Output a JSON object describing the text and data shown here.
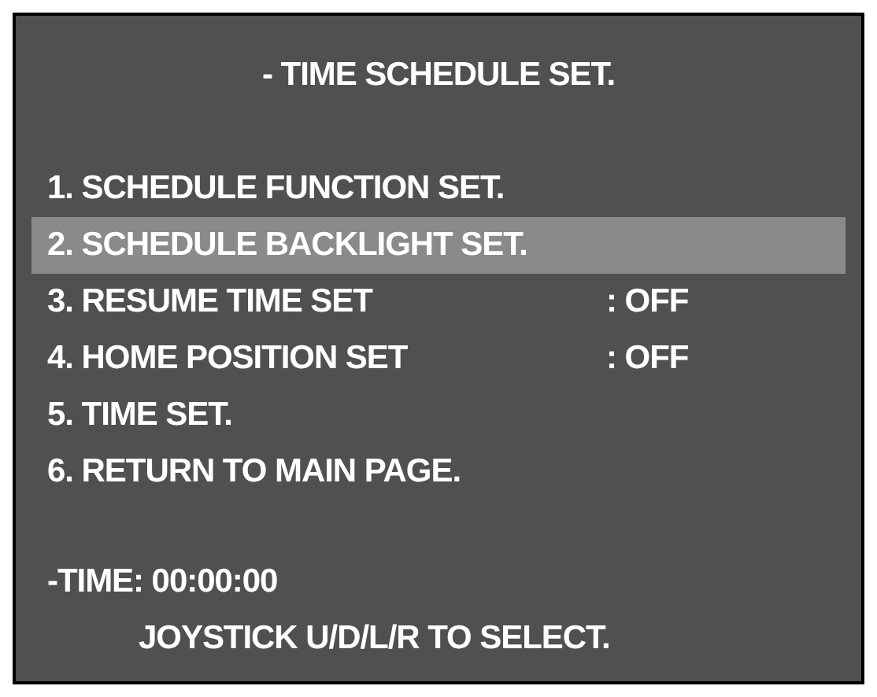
{
  "title": "- TIME SCHEDULE SET.",
  "items": [
    {
      "label": "1. SCHEDULE FUNCTION SET.",
      "selected": false
    },
    {
      "label": "2. SCHEDULE BACKLIGHT SET.",
      "selected": true
    },
    {
      "label": "3. RESUME TIME SET",
      "value": ": OFF",
      "selected": false
    },
    {
      "label": "4. HOME POSITION SET",
      "value": ": OFF",
      "selected": false
    },
    {
      "label": "5. TIME SET.",
      "selected": false
    },
    {
      "label": "6. RETURN TO MAIN PAGE.",
      "selected": false
    }
  ],
  "time": "-TIME: 00:00:00",
  "hint": "JOYSTICK U/D/L/R TO SELECT."
}
